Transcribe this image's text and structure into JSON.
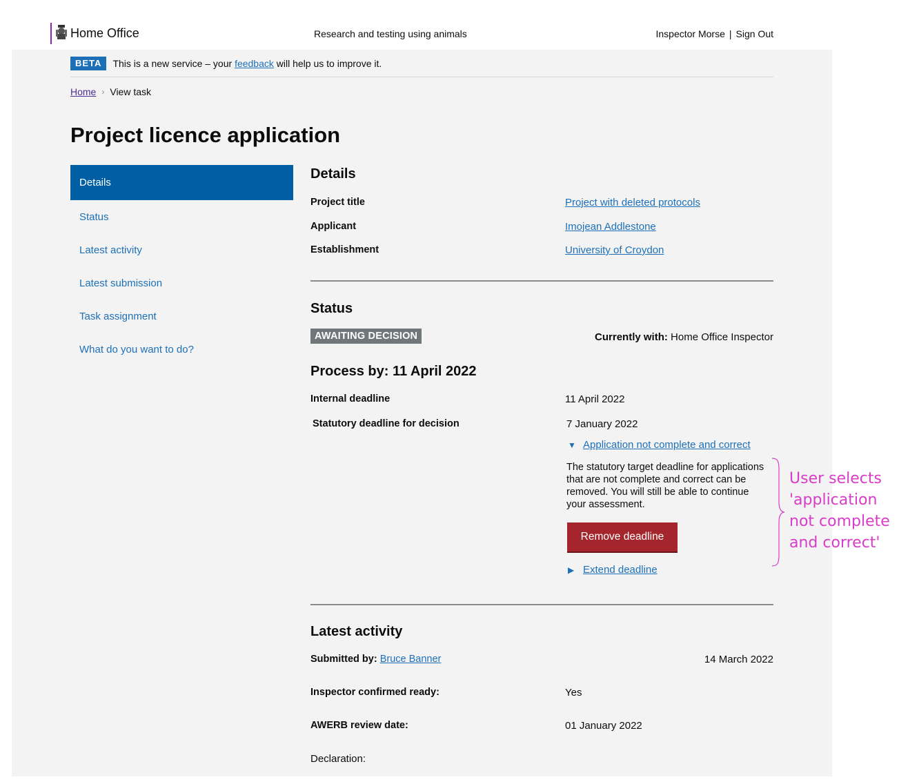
{
  "header": {
    "brand": "Home Office",
    "service_name": "Research and testing using animals",
    "user_name": "Inspector Morse",
    "separator": "|",
    "sign_out": "Sign Out"
  },
  "phase_banner": {
    "tag": "BETA",
    "text_before": "This is a new service – your",
    "link": "feedback",
    "text_after": "will help us to improve it."
  },
  "breadcrumb": {
    "home": "Home",
    "current": "View task"
  },
  "page_title": "Project licence application",
  "side_nav": {
    "items": [
      {
        "label": "Details"
      },
      {
        "label": "Status"
      },
      {
        "label": "Latest activity"
      },
      {
        "label": "Latest submission"
      },
      {
        "label": "Task assignment"
      },
      {
        "label": "What do you want to do?"
      }
    ]
  },
  "details": {
    "heading": "Details",
    "project_title_label": "Project title",
    "project_title_value": "Project with deleted protocols",
    "applicant_label": "Applicant",
    "applicant_value": "Imojean Addlestone",
    "establishment_label": "Establishment",
    "establishment_value": "University of Croydon"
  },
  "status": {
    "heading": "Status",
    "tag": "AWAITING DECISION",
    "currently_with_label": "Currently with:",
    "currently_with_value": "Home Office Inspector",
    "process_by": "Process by: 11 April 2022",
    "internal_deadline_label": "Internal deadline",
    "internal_deadline_value": "11 April 2022",
    "statutory_label": "Statutory deadline for decision",
    "statutory_value": "7 January 2022",
    "not_complete_toggle": "Application not complete and correct",
    "help_text": "The statutory target deadline for applications that are not complete and correct can be removed. You will still be able to continue your assessment.",
    "remove_button": "Remove deadline",
    "extend_toggle": "Extend deadline"
  },
  "annotation": {
    "text": "User selects 'application not complete and correct'",
    "color": "#d93cc8"
  },
  "latest_activity": {
    "heading": "Latest activity",
    "submitted_by_label": "Submitted by:",
    "submitted_by_value": "Bruce Banner",
    "submitted_date": "14 March 2022",
    "inspector_ready_label": "Inspector confirmed ready:",
    "inspector_ready_value": "Yes",
    "awerb_label": "AWERB review date:",
    "awerb_value": "01 January 2022",
    "declaration_label": "Declaration:"
  },
  "colors": {
    "link": "#1d70b8",
    "active_nav": "#005ea5",
    "beta": "#1d70b8",
    "status_tag": "#6f777b",
    "warning_button": "#a4262c",
    "brand_bar": "#8f23b3"
  }
}
